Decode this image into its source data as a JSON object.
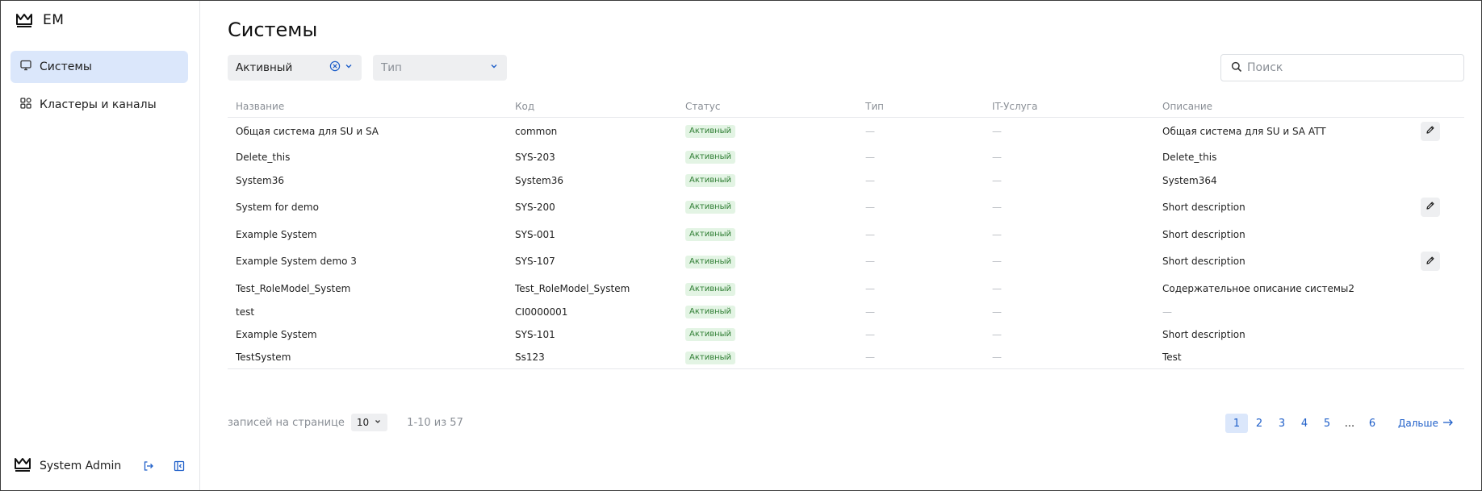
{
  "app": {
    "logo_text": "EM"
  },
  "sidebar": {
    "items": [
      {
        "label": "Системы",
        "icon": "monitor-icon",
        "active": true
      },
      {
        "label": "Кластеры и каналы",
        "icon": "grid-apps-icon",
        "active": false
      }
    ],
    "user": {
      "name": "System Admin"
    }
  },
  "header": {
    "title": "Системы"
  },
  "filters": {
    "status": {
      "value": "Активный"
    },
    "type": {
      "placeholder": "Тип"
    }
  },
  "search": {
    "placeholder": "Поиск"
  },
  "table": {
    "columns": [
      "Название",
      "Код",
      "Статус",
      "Тип",
      "IT-Услуга",
      "Описание"
    ],
    "rows": [
      {
        "name": "Общая система для SU и SA",
        "code": "common",
        "status": "Активный",
        "type": "—",
        "service": "—",
        "description": "Общая система для SU и SA ATT",
        "editable": true
      },
      {
        "name": "Delete_this",
        "code": "SYS-203",
        "status": "Активный",
        "type": "—",
        "service": "—",
        "description": "Delete_this",
        "editable": false
      },
      {
        "name": "System36",
        "code": "System36",
        "status": "Активный",
        "type": "—",
        "service": "—",
        "description": "System364",
        "editable": false
      },
      {
        "name": "System for demo",
        "code": "SYS-200",
        "status": "Активный",
        "type": "—",
        "service": "—",
        "description": "Short description",
        "editable": true
      },
      {
        "name": "Example System",
        "code": "SYS-001",
        "status": "Активный",
        "type": "—",
        "service": "—",
        "description": "Short description",
        "editable": false
      },
      {
        "name": "Example System demo 3",
        "code": "SYS-107",
        "status": "Активный",
        "type": "—",
        "service": "—",
        "description": "Short description",
        "editable": true
      },
      {
        "name": "Test_RoleModel_System",
        "code": "Test_RoleModel_System",
        "status": "Активный",
        "type": "—",
        "service": "—",
        "description": "Содержательное описание системы2",
        "editable": false
      },
      {
        "name": "test",
        "code": "CI0000001",
        "status": "Активный",
        "type": "—",
        "service": "—",
        "description": "—",
        "editable": false
      },
      {
        "name": "Example System",
        "code": "SYS-101",
        "status": "Активный",
        "type": "—",
        "service": "—",
        "description": "Short description",
        "editable": false
      },
      {
        "name": "TestSystem",
        "code": "Ss123",
        "status": "Активный",
        "type": "—",
        "service": "—",
        "description": "Test",
        "editable": false
      }
    ]
  },
  "pagination": {
    "per_page_label": "записей на странице",
    "per_page_value": "10",
    "range_text": "1-10 из 57",
    "pages": [
      "1",
      "2",
      "3",
      "4",
      "5"
    ],
    "ellipsis": "...",
    "last_page": "6",
    "current_page": "1",
    "next_label": "Дальше"
  },
  "colors": {
    "accent": "#1f5fc9",
    "active_nav_bg": "#dbe7fb",
    "badge_bg": "#e3f4e4",
    "badge_text": "#2e7d32"
  }
}
